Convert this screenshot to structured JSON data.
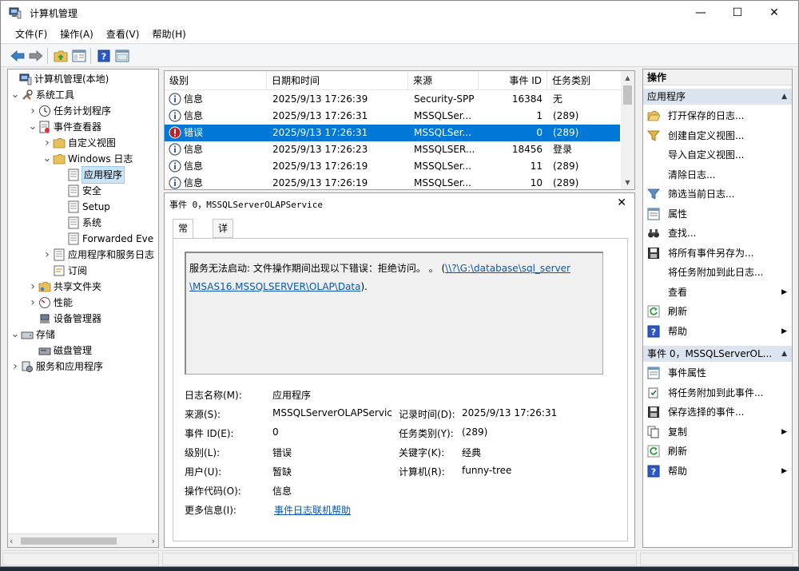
{
  "window": {
    "title": "计算机管理",
    "minimize_glyph": "—",
    "maximize_glyph": "☐",
    "close_glyph": "✕"
  },
  "menu": [
    "文件(F)",
    "操作(A)",
    "查看(V)",
    "帮助(H)"
  ],
  "toolbar": {
    "icons": [
      "back-arrow-icon",
      "forward-arrow-icon",
      "up-folder-icon",
      "show-hide-tree-icon",
      "help-icon",
      "properties-icon"
    ]
  },
  "tree": {
    "items": [
      {
        "label": "计算机管理(本地)",
        "icon": "computer-management-icon"
      },
      {
        "label": "系统工具",
        "icon": "tools-icon",
        "arrow": "v"
      },
      {
        "label": "任务计划程序",
        "icon": "clock-icon",
        "arrow": ">"
      },
      {
        "label": "事件查看器",
        "icon": "event-viewer-icon",
        "arrow": "v"
      },
      {
        "label": "自定义视图",
        "icon": "folder-icon",
        "arrow": ">"
      },
      {
        "label": "Windows 日志",
        "icon": "folder-icon",
        "arrow": "v"
      },
      {
        "label": "应用程序",
        "icon": "log-icon"
      },
      {
        "label": "安全",
        "icon": "log-icon"
      },
      {
        "label": "Setup",
        "icon": "log-icon"
      },
      {
        "label": "系统",
        "icon": "log-icon"
      },
      {
        "label": "Forwarded Eve",
        "icon": "log-icon"
      },
      {
        "label": "应用程序和服务日志",
        "icon": "log-icon",
        "arrow": ">"
      },
      {
        "label": "订阅",
        "icon": "subscription-icon"
      },
      {
        "label": "共享文件夹",
        "icon": "shared-folder-icon",
        "arrow": ">"
      },
      {
        "label": "性能",
        "icon": "performance-icon",
        "arrow": ">"
      },
      {
        "label": "设备管理器",
        "icon": "device-manager-icon"
      },
      {
        "label": "存储",
        "icon": "storage-icon",
        "arrow": "v"
      },
      {
        "label": "磁盘管理",
        "icon": "disk-icon"
      },
      {
        "label": "服务和应用程序",
        "icon": "services-icon",
        "arrow": ">"
      }
    ]
  },
  "events": {
    "columns": [
      "级别",
      "日期和时间",
      "来源",
      "事件 ID",
      "任务类别"
    ],
    "rows": [
      {
        "level": "信息",
        "datetime": "2025/9/13 17:26:39",
        "source": "Security-SPP",
        "id": "16384",
        "category": "无"
      },
      {
        "level": "信息",
        "datetime": "2025/9/13 17:26:31",
        "source": "MSSQLSer...",
        "id": "1",
        "category": "(289)"
      },
      {
        "level": "错误",
        "datetime": "2025/9/13 17:26:31",
        "source": "MSSQLSer...",
        "id": "0",
        "category": "(289)"
      },
      {
        "level": "信息",
        "datetime": "2025/9/13 17:26:23",
        "source": "MSSQLSER...",
        "id": "18456",
        "category": "登录"
      },
      {
        "level": "信息",
        "datetime": "2025/9/13 17:26:19",
        "source": "MSSQLSer...",
        "id": "11",
        "category": "(289)"
      },
      {
        "level": "信息",
        "datetime": "2025/9/13 17:26:19",
        "source": "MSSQLSer...",
        "id": "10",
        "category": "(289)"
      }
    ]
  },
  "detail": {
    "title": "事件 0，MSSQLServerOLAPService",
    "close": "✕",
    "tabs": [
      "常规",
      "详细信息"
    ],
    "message_text": "服务无法启动: 文件操作期间出现以下错误：拒绝访问。 。 (",
    "message_link_1": "\\\\?\\G:\\database\\sql_server",
    "message_link_2": "\\MSAS16.MSSQLSERVER\\OLAP\\Data",
    "message_tail": ").",
    "fields": {
      "log_name_label": "日志名称(M):",
      "log_name": "应用程序",
      "source_label": "来源(S):",
      "source": "MSSQLServerOLAPService",
      "logged_label": "记录时间(D):",
      "logged": "2025/9/13 17:26:31",
      "event_id_label": "事件 ID(E):",
      "event_id": "0",
      "task_label": "任务类别(Y):",
      "task": "(289)",
      "level_label": "级别(L):",
      "level": "错误",
      "keywords_label": "关键字(K):",
      "keywords": "经典",
      "user_label": "用户(U):",
      "user": "暂缺",
      "computer_label": "计算机(R):",
      "computer": "funny-tree",
      "opcode_label": "操作代码(O):",
      "opcode": "信息",
      "more_label": "更多信息(I):",
      "more_link": "事件日志联机帮助"
    }
  },
  "actions": {
    "header": "操作",
    "section1": "应用程序",
    "items1": [
      {
        "label": "打开保存的日志...",
        "icon": "open-folder-icon"
      },
      {
        "label": "创建自定义视图...",
        "icon": "filter-create-icon"
      },
      {
        "label": "导入自定义视图...",
        "icon": ""
      },
      {
        "label": "清除日志...",
        "icon": ""
      },
      {
        "label": "筛选当前日志...",
        "icon": "filter-icon"
      },
      {
        "label": "属性",
        "icon": "properties-icon"
      },
      {
        "label": "查找...",
        "icon": "binoculars-icon"
      },
      {
        "label": "将所有事件另存为...",
        "icon": "save-icon"
      },
      {
        "label": "将任务附加到此日志...",
        "icon": ""
      },
      {
        "label": "查看",
        "icon": "",
        "submenu": true
      },
      {
        "label": "刷新",
        "icon": "refresh-icon"
      },
      {
        "label": "帮助",
        "icon": "help-icon",
        "submenu": true
      }
    ],
    "section2": "事件 0，MSSQLServerOL...",
    "items2": [
      {
        "label": "事件属性",
        "icon": "event-properties-icon"
      },
      {
        "label": "将任务附加到此事件...",
        "icon": "attach-task-icon"
      },
      {
        "label": "保存选择的事件...",
        "icon": "save-icon"
      },
      {
        "label": "复制",
        "icon": "copy-icon",
        "submenu": true
      },
      {
        "label": "刷新",
        "icon": "refresh-icon"
      },
      {
        "label": "帮助",
        "icon": "help-icon",
        "submenu": true
      }
    ]
  },
  "colors": {
    "selection": "#0078d7",
    "tree_selection": "#cce4f7",
    "section_header": "#dbe4ef",
    "link": "#0b57b5"
  }
}
